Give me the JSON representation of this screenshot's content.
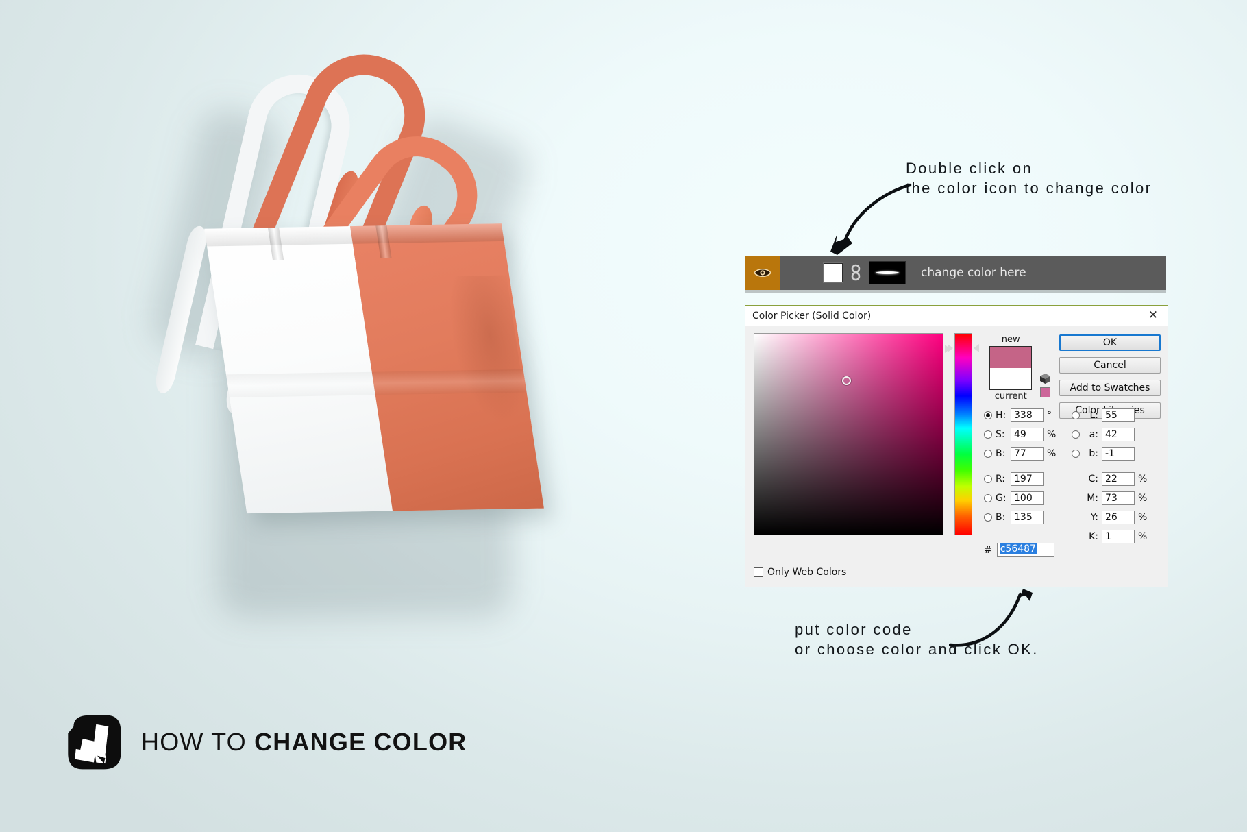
{
  "theme": {
    "background_left": "#d5e0e1",
    "background_right": "#f2fdfd",
    "bag_coral": "#e27c5d",
    "bag_white": "#ffffff",
    "accent_blue": "#1878d0",
    "dialog_border_green": "#8aa13d",
    "eye_button_orange": "#b9760c"
  },
  "annotations": {
    "top_line1": "Double click on",
    "top_line2": "the color icon to change color",
    "bottom_line1": "put color code",
    "bottom_line2": "or choose color and click OK."
  },
  "layer_bar": {
    "eye_icon": "eye-icon",
    "link_icon": "link-chain-icon",
    "layer_name": "change color here"
  },
  "color_picker": {
    "title": "Color Picker (Solid Color)",
    "close_icon": "close-icon",
    "swatch_new_label": "new",
    "swatch_current_label": "current",
    "swatch_new_color": "#c56487",
    "swatch_current_color": "#ffffff",
    "gamut_icon": "out-of-gamut-cube-icon",
    "websafe_chip_color": "#cc6699",
    "buttons": {
      "ok": "OK",
      "cancel": "Cancel",
      "add_to_swatches": "Add to Swatches",
      "color_libraries": "Color Libraries"
    },
    "only_web_colors": {
      "label": "Only Web Colors",
      "checked": false
    },
    "hex": {
      "symbol": "#",
      "value": "c56487",
      "selected": true
    },
    "fields": [
      {
        "selected": true,
        "name": "H:",
        "value": "338",
        "unit": "°",
        "r_radio": true,
        "r_selected": false,
        "r_name": "L:",
        "r_value": "55",
        "r_unit": ""
      },
      {
        "selected": false,
        "name": "S:",
        "value": "49",
        "unit": "%",
        "r_radio": true,
        "r_selected": false,
        "r_name": "a:",
        "r_value": "42",
        "r_unit": ""
      },
      {
        "selected": false,
        "name": "B:",
        "value": "77",
        "unit": "%",
        "r_radio": true,
        "r_selected": false,
        "r_name": "b:",
        "r_value": "-1",
        "r_unit": ""
      },
      {
        "selected": false,
        "name": "R:",
        "value": "197",
        "unit": "",
        "r_radio": false,
        "r_selected": false,
        "r_name": "C:",
        "r_value": "22",
        "r_unit": "%"
      },
      {
        "selected": false,
        "name": "G:",
        "value": "100",
        "unit": "",
        "r_radio": false,
        "r_selected": false,
        "r_name": "M:",
        "r_value": "73",
        "r_unit": "%"
      },
      {
        "selected": false,
        "name": "B:",
        "value": "135",
        "unit": "",
        "r_radio": false,
        "r_selected": false,
        "r_name": "Y:",
        "r_value": "26",
        "r_unit": "%"
      },
      {
        "spacer": true,
        "r_radio": false,
        "r_selected": false,
        "r_name": "K:",
        "r_value": "1",
        "r_unit": "%"
      }
    ]
  },
  "product": {
    "name": "tote-bag-mockup",
    "body_left_color": "#ffffff",
    "body_right_color": "#e27c5d",
    "handle_left_color": "#f4f6f7",
    "handle_right_color": "#e27c5d"
  },
  "footer": {
    "logo_icon": "color-swatch-logo-icon",
    "title_light": "HOW TO ",
    "title_bold": "CHANGE COLOR"
  }
}
